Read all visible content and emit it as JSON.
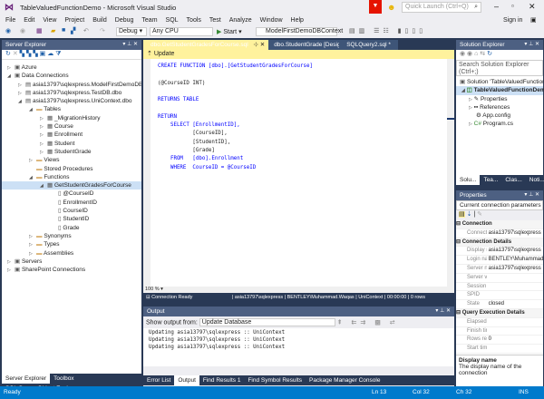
{
  "window": {
    "title": "TableValuedFunctionDemo - Microsoft Visual Studio",
    "quick_launch_placeholder": "Quick Launch (Ctrl+Q)",
    "sign_in": "Sign in"
  },
  "menu": [
    "File",
    "Edit",
    "View",
    "Project",
    "Build",
    "Debug",
    "Team",
    "SQL",
    "Tools",
    "Test",
    "Analyze",
    "Window",
    "Help"
  ],
  "toolbar": {
    "config": "Debug",
    "platform": "Any CPU",
    "start": "Start",
    "context": "ModelFirstDemoDBContext"
  },
  "server_explorer": {
    "title": "Server Explorer",
    "tree": [
      {
        "label": "Azure",
        "level": 0,
        "exp": "▷"
      },
      {
        "label": "Data Connections",
        "level": 0,
        "exp": "◢"
      },
      {
        "label": "asia13797\\sqlexpress.ModelFirstDemoDB.dbo",
        "level": 1,
        "exp": "▷"
      },
      {
        "label": "asia13797\\sqlexpress.TestDB.dbo",
        "level": 1,
        "exp": "▷"
      },
      {
        "label": "asia13797\\sqlexpress.UniContext.dbo",
        "level": 1,
        "exp": "◢"
      },
      {
        "label": "Tables",
        "level": 2,
        "exp": "◢"
      },
      {
        "label": "_MigrationHistory",
        "level": 3,
        "exp": "▷"
      },
      {
        "label": "Course",
        "level": 3,
        "exp": "▷"
      },
      {
        "label": "Enrollment",
        "level": 3,
        "exp": "▷"
      },
      {
        "label": "Student",
        "level": 3,
        "exp": "▷"
      },
      {
        "label": "StudentGrade",
        "level": 3,
        "exp": "▷"
      },
      {
        "label": "Views",
        "level": 2,
        "exp": "▷"
      },
      {
        "label": "Stored Procedures",
        "level": 2,
        "exp": ""
      },
      {
        "label": "Functions",
        "level": 2,
        "exp": "◢"
      },
      {
        "label": "GetStudentGradesForCourse",
        "level": 3,
        "exp": "◢",
        "selected": true
      },
      {
        "label": "@CourseID",
        "level": 4,
        "exp": ""
      },
      {
        "label": "EnrollmentID",
        "level": 4,
        "exp": ""
      },
      {
        "label": "CourseID",
        "level": 4,
        "exp": ""
      },
      {
        "label": "StudentID",
        "level": 4,
        "exp": ""
      },
      {
        "label": "Grade",
        "level": 4,
        "exp": ""
      },
      {
        "label": "Synonyms",
        "level": 2,
        "exp": "▷"
      },
      {
        "label": "Types",
        "level": 2,
        "exp": "▷"
      },
      {
        "label": "Assemblies",
        "level": 2,
        "exp": "▷"
      },
      {
        "label": "Servers",
        "level": 0,
        "exp": "▷"
      },
      {
        "label": "SharePoint Connections",
        "level": 0,
        "exp": "▷"
      }
    ],
    "bottom_tabs": [
      "Server Explorer",
      "Toolbox",
      "SQL Server Object Explorer"
    ]
  },
  "editor": {
    "tabs": [
      "dbo.GetStudentGradesForCourse.sql",
      "dbo.StudentGrade [Design]",
      "SQLQuery2.sql *"
    ],
    "update": "Update",
    "code": [
      "CREATE FUNCTION [dbo].[GetStudentGradesForCourse]",
      "",
      "(@CourseID INT)",
      "",
      "RETURNS TABLE",
      "",
      "RETURN",
      "    SELECT [EnrollmentID],",
      "           [CourseID],",
      "           [StudentID],",
      "           [Grade]",
      "    FROM   [dbo].Enrollment",
      "    WHERE  CourseID = @CourseID"
    ],
    "zoom": "100 %",
    "conn_status": "Connection Ready",
    "conn_server": "asia13797\\sqlexpress",
    "conn_user": "BENTLEY\\Muhammad.Waqas",
    "conn_db": "UniContext",
    "conn_time": "00:00:00",
    "conn_rows": "0 rows"
  },
  "output": {
    "title": "Output",
    "show_from_label": "Show output from:",
    "source": "Update Database",
    "lines": [
      "Updating asia13797\\sqlexpress :: UniContext",
      "Updating asia13797\\sqlexpress :: UniContext",
      "Updating asia13797\\sqlexpress :: UniContext"
    ],
    "tabs": [
      "Error List",
      "Output",
      "Find Results 1",
      "Find Symbol Results",
      "Package Manager Console"
    ]
  },
  "solution_explorer": {
    "title": "Solution Explorer",
    "search_placeholder": "Search Solution Explorer (Ctrl+;)",
    "tree": [
      "Solution 'TableValuedFunctionDemo'",
      "TableValuedFunctionDemo",
      "Properties",
      "References",
      "App.config",
      "Program.cs"
    ],
    "tabs": [
      "Solu...",
      "Tea...",
      "Clas...",
      "Noti..."
    ]
  },
  "properties": {
    "title": "Properties",
    "object": "Current connection parameters",
    "rows": [
      {
        "cat": "Connection"
      },
      {
        "k": "Connection",
        "v": "asia13797\\sqlexpress"
      },
      {
        "cat": "Connection Details"
      },
      {
        "k": "Display name",
        "v": "asia13797\\sqlexpress"
      },
      {
        "k": "Login name",
        "v": "BENTLEY\\Muhammad.Waqas"
      },
      {
        "k": "Server name",
        "v": "asia13797\\sqlexpress"
      },
      {
        "k": "Server version",
        "v": ""
      },
      {
        "k": "Session Tracing ID",
        "v": ""
      },
      {
        "k": "SPID",
        "v": ""
      },
      {
        "k": "State",
        "v": "closed"
      },
      {
        "cat": "Query Execution Details"
      },
      {
        "k": "Elapsed time",
        "v": ""
      },
      {
        "k": "Finish time",
        "v": ""
      },
      {
        "k": "Rows returned",
        "v": "0"
      },
      {
        "k": "Start time",
        "v": ""
      }
    ],
    "desc_title": "Display name",
    "desc_text": "The display name of the connection"
  },
  "status": {
    "text": "Ready",
    "ln": "Ln 13",
    "col": "Col 32",
    "ch": "Ch 32",
    "mode": "INS"
  },
  "colors": {
    "accent": "#007acc",
    "panel_header": "#4d6082",
    "active_tab": "#fff29d",
    "notification": "#e51400"
  }
}
